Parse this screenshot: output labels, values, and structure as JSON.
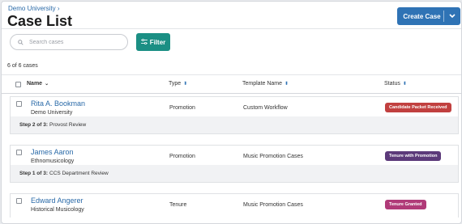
{
  "breadcrumb": "Demo University",
  "breadcrumb_chevron": "›",
  "title": "Case List",
  "create_button": {
    "label": "Create Case"
  },
  "search": {
    "placeholder": "Search cases"
  },
  "filter_button": {
    "label": "Filter"
  },
  "count_text": "6 of 6 cases",
  "columns": {
    "name": "Name",
    "type": "Type",
    "template": "Template Name",
    "status": "Status"
  },
  "rows": [
    {
      "name": "Rita A. Bookman",
      "subtitle": "Demo University",
      "type": "Promotion",
      "template": "Custom Workflow",
      "status": "Candidate Packet Received",
      "status_color": "#c1403f",
      "step_label": "Step 2 of 3:",
      "step_value": "Provost Review"
    },
    {
      "name": "James Aaron",
      "subtitle": "Ethnomusicology",
      "type": "Promotion",
      "template": "Music Promotion Cases",
      "status": "Tenure with Promotion",
      "status_color": "#5c3a7a",
      "step_label": "Step 1 of 3:",
      "step_value": "CCS Department Review"
    },
    {
      "name": "Edward Angerer",
      "subtitle": "Historical Musicology",
      "type": "Tenure",
      "template": "Music Promotion Cases",
      "status": "Tenure Granted",
      "status_color": "#b03a78"
    }
  ],
  "colors": {
    "primary": "#2f73b5",
    "filter": "#1b8f84",
    "link": "#2a6aa8"
  }
}
